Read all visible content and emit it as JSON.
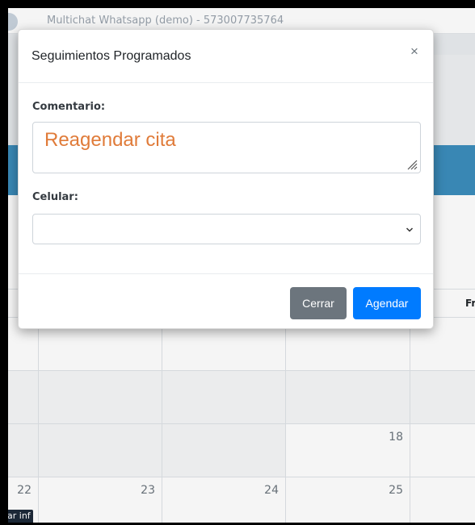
{
  "app": {
    "title": "Multichat Whatsapp (demo) - 573007735764"
  },
  "calendar": {
    "header_visible": "Fr",
    "rows": [
      {
        "days": [
          "",
          "",
          "",
          "18",
          ""
        ]
      },
      {
        "days": [
          "22",
          "23",
          "24",
          "25",
          ""
        ]
      }
    ],
    "event_pill": "ar inf"
  },
  "modal": {
    "title": "Seguimientos Programados",
    "close_glyph": "×",
    "comment_label": "Comentario:",
    "comment_value": "Reagendar cita",
    "phone_label": "Celular:",
    "phone_value": "",
    "buttons": {
      "close": "Cerrar",
      "schedule": "Agendar"
    }
  },
  "colors": {
    "primary": "#007bff",
    "secondary": "#6c757d",
    "header_blue": "#3c8dbc",
    "comment_text": "#e07b39"
  }
}
